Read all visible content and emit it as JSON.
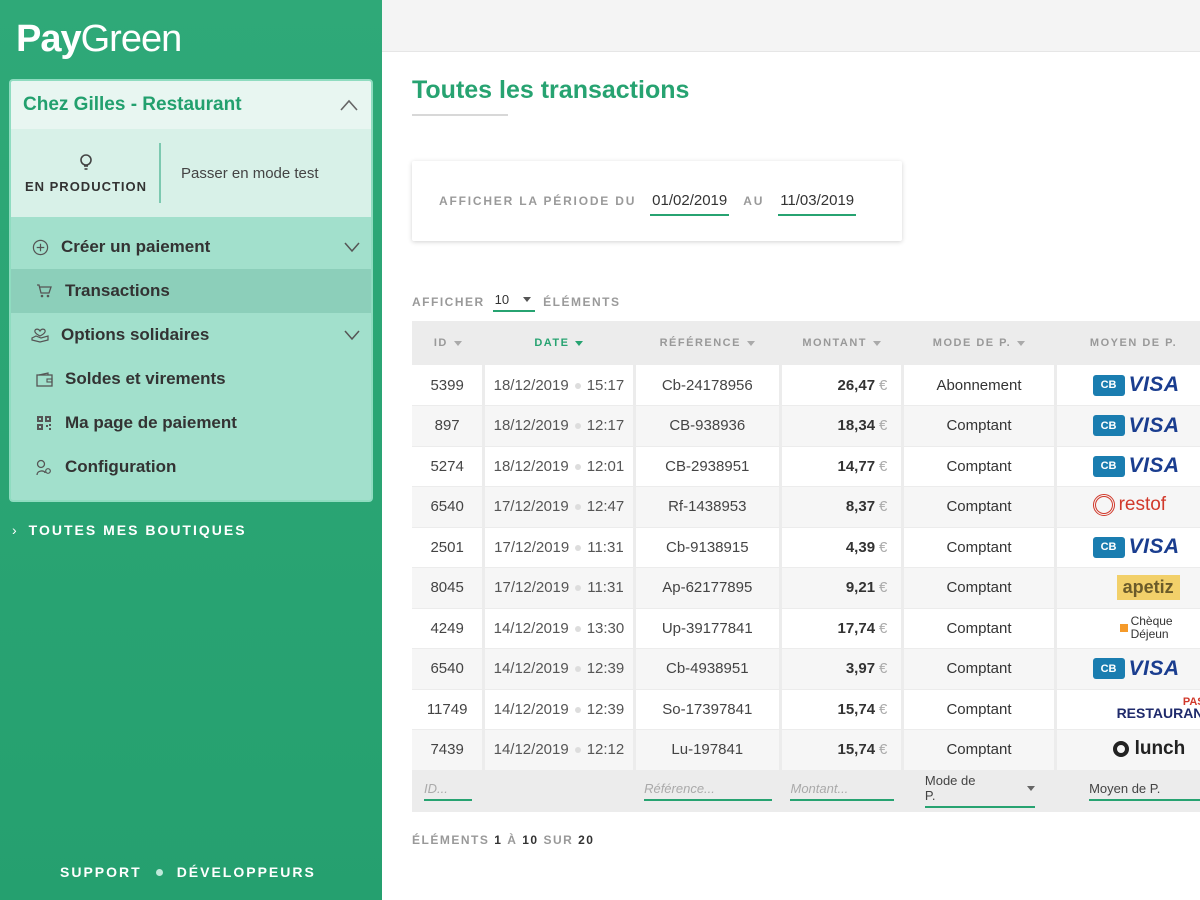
{
  "brand": {
    "logo_bold": "Pay",
    "logo_light": "Green"
  },
  "shop": {
    "name": "Chez Gilles - Restaurant",
    "status_label": "EN PRODUCTION",
    "test_mode_label": "Passer en mode test"
  },
  "nav": {
    "items": [
      {
        "label": "Créer un paiement",
        "icon": "plus-circle-icon"
      },
      {
        "label": "Transactions",
        "icon": "cart-icon"
      },
      {
        "label": "Options solidaires",
        "icon": "charity-icon"
      },
      {
        "label": "Soldes et virements",
        "icon": "wallet-icon"
      },
      {
        "label": "Ma page de paiement",
        "icon": "qr-icon"
      },
      {
        "label": "Configuration",
        "icon": "settings-icon"
      }
    ],
    "all_shops": "TOUTES MES BOUTIQUES"
  },
  "footer": {
    "support": "SUPPORT",
    "developers": "DÉVELOPPEURS"
  },
  "page": {
    "title": "Toutes les transactions"
  },
  "period": {
    "label_from": "AFFICHER LA PÉRIODE DU",
    "from": "01/02/2019",
    "label_to": "AU",
    "to": "11/03/2019"
  },
  "listing": {
    "show_label": "AFFICHER",
    "per_page": "10",
    "elements_label": "ÉLÉMENTS"
  },
  "table": {
    "headers": [
      "ID",
      "DATE",
      "RÉFÉRENCE",
      "MONTANT",
      "MODE DE P.",
      "MOYEN DE P."
    ],
    "currency": "€",
    "rows": [
      {
        "id": "5399",
        "date": "18/12/2019",
        "time": "15:17",
        "ref": "Cb-24178956",
        "amount": "26,47",
        "mode": "Abonnement",
        "method": "cb-visa"
      },
      {
        "id": "897",
        "date": "18/12/2019",
        "time": "12:17",
        "ref": "CB-938936",
        "amount": "18,34",
        "mode": "Comptant",
        "method": "cb-visa"
      },
      {
        "id": "5274",
        "date": "18/12/2019",
        "time": "12:01",
        "ref": "CB-2938951",
        "amount": "14,77",
        "mode": "Comptant",
        "method": "cb-visa"
      },
      {
        "id": "6540",
        "date": "17/12/2019",
        "time": "12:47",
        "ref": "Rf-1438953",
        "amount": "8,37",
        "mode": "Comptant",
        "method": "restoflash"
      },
      {
        "id": "2501",
        "date": "17/12/2019",
        "time": "11:31",
        "ref": "Cb-9138915",
        "amount": "4,39",
        "mode": "Comptant",
        "method": "cb-visa"
      },
      {
        "id": "8045",
        "date": "17/12/2019",
        "time": "11:31",
        "ref": "Ap-62177895",
        "amount": "9,21",
        "mode": "Comptant",
        "method": "apetiz"
      },
      {
        "id": "4249",
        "date": "14/12/2019",
        "time": "13:30",
        "ref": "Up-39177841",
        "amount": "17,74",
        "mode": "Comptant",
        "method": "cheque-dejeuner"
      },
      {
        "id": "6540",
        "date": "14/12/2019",
        "time": "12:39",
        "ref": "Cb-4938951",
        "amount": "3,97",
        "mode": "Comptant",
        "method": "cb-visa"
      },
      {
        "id": "11749",
        "date": "14/12/2019",
        "time": "12:39",
        "ref": "So-17397841",
        "amount": "15,74",
        "mode": "Comptant",
        "method": "pass-restaurant"
      },
      {
        "id": "7439",
        "date": "14/12/2019",
        "time": "12:12",
        "ref": "Lu-197841",
        "amount": "15,74",
        "mode": "Comptant",
        "method": "lunchr"
      }
    ],
    "filters": {
      "id": "ID...",
      "ref": "Référence...",
      "amount": "Montant...",
      "mode": "Mode de P.",
      "method": "Moyen de P."
    }
  },
  "logos": {
    "cb": "CB",
    "visa": "VISA",
    "restoflash": "restof",
    "apetiz": "apetiz",
    "cheque_l1": "Chèque",
    "cheque_l2": "Déjeun",
    "pass": "PASS",
    "restaurant": "RESTAURANT",
    "lunchr": "lunch"
  },
  "pager": {
    "prefix": "ÉLÉMENTS",
    "from": "1",
    "a": "À",
    "to": "10",
    "sur": "SUR",
    "total": "20"
  },
  "colors": {
    "brand_green": "#27a371",
    "sidebar": "#2fa978",
    "panel": "#a2e0cc"
  }
}
